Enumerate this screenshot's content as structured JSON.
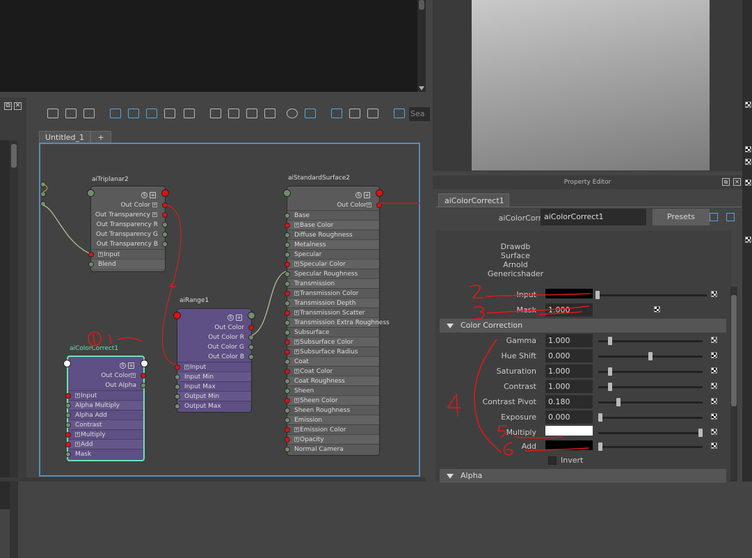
{
  "node_editor": {
    "tab_label": "Untitled_1",
    "add_tab_label": "+",
    "search_placeholder": "Sea"
  },
  "nodes": {
    "triplanar": {
      "title": "aiTriplanar2",
      "outputs": [
        "Out Color",
        "Out Transparency",
        "Out Transparency R",
        "Out Transparency G",
        "Out Transparency B"
      ],
      "inputs": [
        "Input",
        "Blend"
      ]
    },
    "standard_surface": {
      "title": "aiStandardSurface2",
      "output": "Out Color",
      "inputs": [
        "Base",
        "Base Color",
        "Diffuse Roughness",
        "Metalness",
        "Specular",
        "Specular Color",
        "Specular Roughness",
        "Transmission",
        "Transmission Color",
        "Transmission Depth",
        "Transmission Scatter",
        "Transmission Extra Roughness",
        "Subsurface",
        "Subsurface Color",
        "Subsurface Radius",
        "Coat",
        "Coat Color",
        "Coat Roughness",
        "Sheen",
        "Sheen Color",
        "Sheen Roughness",
        "Emission",
        "Emission Color",
        "Opacity",
        "Normal Camera"
      ]
    },
    "range": {
      "title": "aiRange1",
      "outputs": [
        "Out Color",
        "Out Color R",
        "Out Color G",
        "Out Color B"
      ],
      "inputs": [
        "Input",
        "Input Min",
        "Input Max",
        "Output Min",
        "Output Max"
      ]
    },
    "color_correct": {
      "title": "aiColorCorrect1",
      "outputs": [
        "Out Color",
        "Out Alpha"
      ],
      "inputs": [
        "Input",
        "Alpha Multiply",
        "Alpha Add",
        "Contrast",
        "Multiply",
        "Add",
        "Mask"
      ]
    }
  },
  "property_editor": {
    "title": "Property Editor",
    "tab_label": "aiColorCorrect1",
    "node_type_label": "aiColorCorrect:",
    "node_name": "aiColorCorrect1",
    "presets_label": "Presets",
    "tags": [
      "Drawdb",
      "Surface",
      "Arnold",
      "Genericshader"
    ],
    "input_label": "Input",
    "mask_label": "Mask",
    "mask_value": "1.000",
    "section_color_correction": "Color Correction",
    "section_alpha": "Alpha",
    "attributes": [
      {
        "label": "Gamma",
        "value": "1.000",
        "slider": 0.1
      },
      {
        "label": "Hue Shift",
        "value": "0.000",
        "slider": 0.5
      },
      {
        "label": "Saturation",
        "value": "1.000",
        "slider": 0.1
      },
      {
        "label": "Contrast",
        "value": "1.000",
        "slider": 0.1
      },
      {
        "label": "Contrast Pivot",
        "value": "0.180",
        "slider": 0.18
      },
      {
        "label": "Exposure",
        "value": "0.000",
        "slider": 0.0
      }
    ],
    "multiply_label": "Multiply",
    "add_label": "Add",
    "invert_label": "Invert",
    "colors": {
      "input_color": "#000000",
      "multiply_color": "#ffffff",
      "add_color": "#000000"
    }
  },
  "annotations": {
    "labels": [
      "①",
      "2",
      "3",
      "4",
      "5",
      "6"
    ]
  }
}
